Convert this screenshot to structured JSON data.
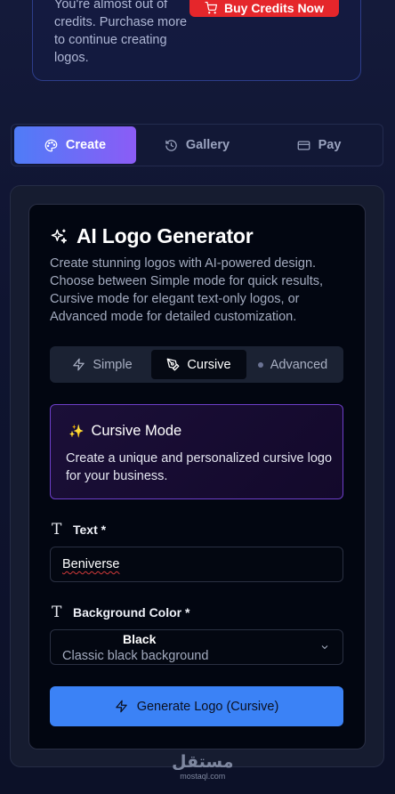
{
  "credits": {
    "message": "You're almost out of credits. Purchase more to continue creating logos.",
    "buy_label": "Buy Credits Now"
  },
  "tabs": [
    {
      "label": "Create",
      "icon": "palette-icon",
      "active": true
    },
    {
      "label": "Gallery",
      "icon": "history-icon",
      "active": false
    },
    {
      "label": "Pay",
      "icon": "credit-card-icon",
      "active": false
    }
  ],
  "generator": {
    "title": "AI Logo Generator",
    "title_icon": "sparkles-icon",
    "description": "Create stunning logos with AI-powered design. Choose between Simple mode for quick results, Cursive mode for elegant text-only logos, or Advanced mode for detailed customization."
  },
  "modes": [
    {
      "label": "Simple",
      "icon": "zap-icon",
      "active": false
    },
    {
      "label": "Cursive",
      "icon": "pen-tool-icon",
      "active": true
    },
    {
      "label": "Advanced",
      "icon": "dot-icon",
      "active": false
    }
  ],
  "cursive_info": {
    "emoji": "✨",
    "title": "Cursive Mode",
    "text": "Create a unique and personalized cursive logo for your business."
  },
  "fields": {
    "text_label": "Text *",
    "text_value": "Beniverse",
    "bg_label": "Background Color *",
    "bg_value": "Black",
    "bg_description": "Classic black background"
  },
  "generate": {
    "label": "Generate Logo (Cursive)"
  },
  "watermark": {
    "main": "مستقل",
    "sub": "mostaql.com"
  },
  "colors": {
    "accent_blue": "#3b82f6",
    "accent_purple": "#8b5cf6",
    "danger": "#e5262b"
  }
}
